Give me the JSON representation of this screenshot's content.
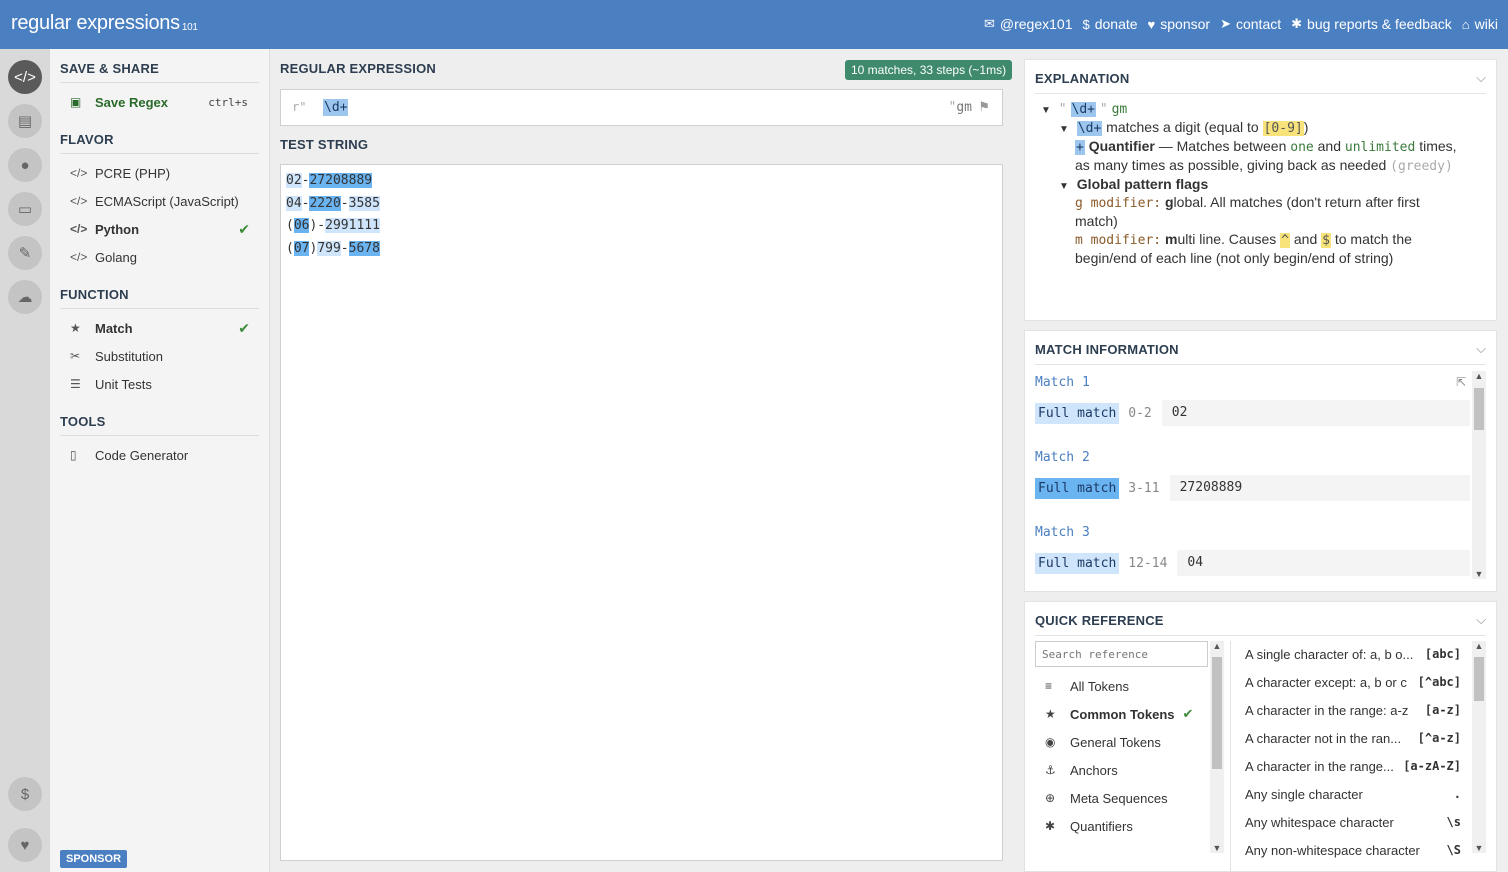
{
  "header": {
    "logo_main": "regular expressions",
    "logo_version": "101",
    "links": [
      {
        "icon": "twitter-icon",
        "glyph": "✉",
        "label": "@regex101"
      },
      {
        "icon": "dollar-icon",
        "glyph": "$",
        "label": "donate"
      },
      {
        "icon": "heart-icon",
        "glyph": "♥",
        "label": "sponsor"
      },
      {
        "icon": "paper-plane-icon",
        "glyph": "➤",
        "label": "contact"
      },
      {
        "icon": "bug-icon",
        "glyph": "✱",
        "label": "bug reports & feedback"
      },
      {
        "icon": "bank-icon",
        "glyph": "⌂",
        "label": "wiki"
      }
    ]
  },
  "sidebar": {
    "save_share_title": "SAVE & SHARE",
    "save_regex_label": "Save Regex",
    "save_regex_shortcut": "ctrl+s",
    "flavor_title": "FLAVOR",
    "flavors": [
      "PCRE (PHP)",
      "ECMAScript (JavaScript)",
      "Python",
      "Golang"
    ],
    "function_title": "FUNCTION",
    "functions": [
      "Match",
      "Substitution",
      "Unit Tests"
    ],
    "tools_title": "TOOLS",
    "tools": [
      "Code Generator"
    ],
    "sponsor_badge": "SPONSOR"
  },
  "editor": {
    "regex_title": "REGULAR EXPRESSION",
    "match_summary": "10 matches, 33 steps (~1ms)",
    "delimiter_left": "r\"",
    "pattern": "\\d+",
    "delimiter_right": "\"",
    "flags": "gm",
    "test_title": "TEST STRING",
    "test_lines": [
      [
        {
          "t": "02",
          "c": "m1"
        },
        {
          "t": "-",
          "c": ""
        },
        {
          "t": "27208889",
          "c": "m2"
        }
      ],
      [
        {
          "t": "04",
          "c": "m1"
        },
        {
          "t": "-",
          "c": ""
        },
        {
          "t": "2220",
          "c": "m2"
        },
        {
          "t": "-",
          "c": ""
        },
        {
          "t": "3585",
          "c": "m1"
        }
      ],
      [
        {
          "t": "(",
          "c": ""
        },
        {
          "t": "06",
          "c": "m2"
        },
        {
          "t": ")-",
          "c": ""
        },
        {
          "t": "2991111",
          "c": "m1"
        }
      ],
      [
        {
          "t": "(",
          "c": ""
        },
        {
          "t": "07",
          "c": "m2"
        },
        {
          "t": ")",
          "c": ""
        },
        {
          "t": "799",
          "c": "m1"
        },
        {
          "t": "-",
          "c": ""
        },
        {
          "t": "5678",
          "c": "m2"
        }
      ]
    ]
  },
  "explanation": {
    "title": "EXPLANATION",
    "root_quote_open": "\"",
    "root_pattern": "\\d+",
    "root_quote_close": "\"",
    "root_flags": "gm",
    "token": "\\d+",
    "token_desc_pre": "matches a digit (equal to",
    "token_class": "[0-9]",
    "token_desc_post": ")",
    "quant_symbol": "+",
    "quant_name": "Quantifier",
    "quant_mid": "— Matches between",
    "quant_one": "one",
    "quant_and": "and",
    "quant_unlimited": "unlimited",
    "quant_times": "times,",
    "quant_line2": "as many times as possible, giving back as needed",
    "quant_greedy": "(greedy)",
    "flags_title": "Global pattern flags",
    "g_mod": "g modifier:",
    "g_bold": "g",
    "g_text": "lobal. All matches (don't return after first",
    "g_text2": "match)",
    "m_mod": "m modifier:",
    "m_bold": "m",
    "m_text_a": "ulti line. Causes",
    "m_caret": "^",
    "m_and": "and",
    "m_dollar": "$",
    "m_text_b": "to match the",
    "m_text2": "begin/end of each line (not only begin/end of string)"
  },
  "match_info": {
    "title": "MATCH INFORMATION",
    "matches": [
      {
        "label": "Match 1",
        "kind": "Full match",
        "range": "0-2",
        "value": "02",
        "shade": "light"
      },
      {
        "label": "Match 2",
        "kind": "Full match",
        "range": "3-11",
        "value": "27208889",
        "shade": "dark"
      },
      {
        "label": "Match 3",
        "kind": "Full match",
        "range": "12-14",
        "value": "04",
        "shade": "light"
      }
    ]
  },
  "quick_ref": {
    "title": "QUICK REFERENCE",
    "search_placeholder": "Search reference",
    "categories": [
      {
        "icon": "database-icon",
        "glyph": "≡",
        "label": "All Tokens"
      },
      {
        "icon": "star-icon",
        "glyph": "★",
        "label": "Common Tokens"
      },
      {
        "icon": "target-icon",
        "glyph": "◉",
        "label": "General Tokens"
      },
      {
        "icon": "anchor-icon",
        "glyph": "⚓",
        "label": "Anchors"
      },
      {
        "icon": "lifebuoy-icon",
        "glyph": "⊕",
        "label": "Meta Sequences"
      },
      {
        "icon": "asterisk-icon",
        "glyph": "✱",
        "label": "Quantifiers"
      }
    ],
    "rows": [
      {
        "desc": "A single character of: a, b o...",
        "token": "[abc]"
      },
      {
        "desc": "A character except: a, b or c",
        "token": "[^abc]"
      },
      {
        "desc": "A character in the range: a-z",
        "token": "[a-z]"
      },
      {
        "desc": "A character not in the ran...",
        "token": "[^a-z]"
      },
      {
        "desc": "A character in the range...",
        "token": "[a-zA-Z]"
      },
      {
        "desc": "Any single character",
        "token": "."
      },
      {
        "desc": "Any whitespace character",
        "token": "\\s"
      },
      {
        "desc": "Any non-whitespace character",
        "token": "\\S"
      }
    ]
  }
}
